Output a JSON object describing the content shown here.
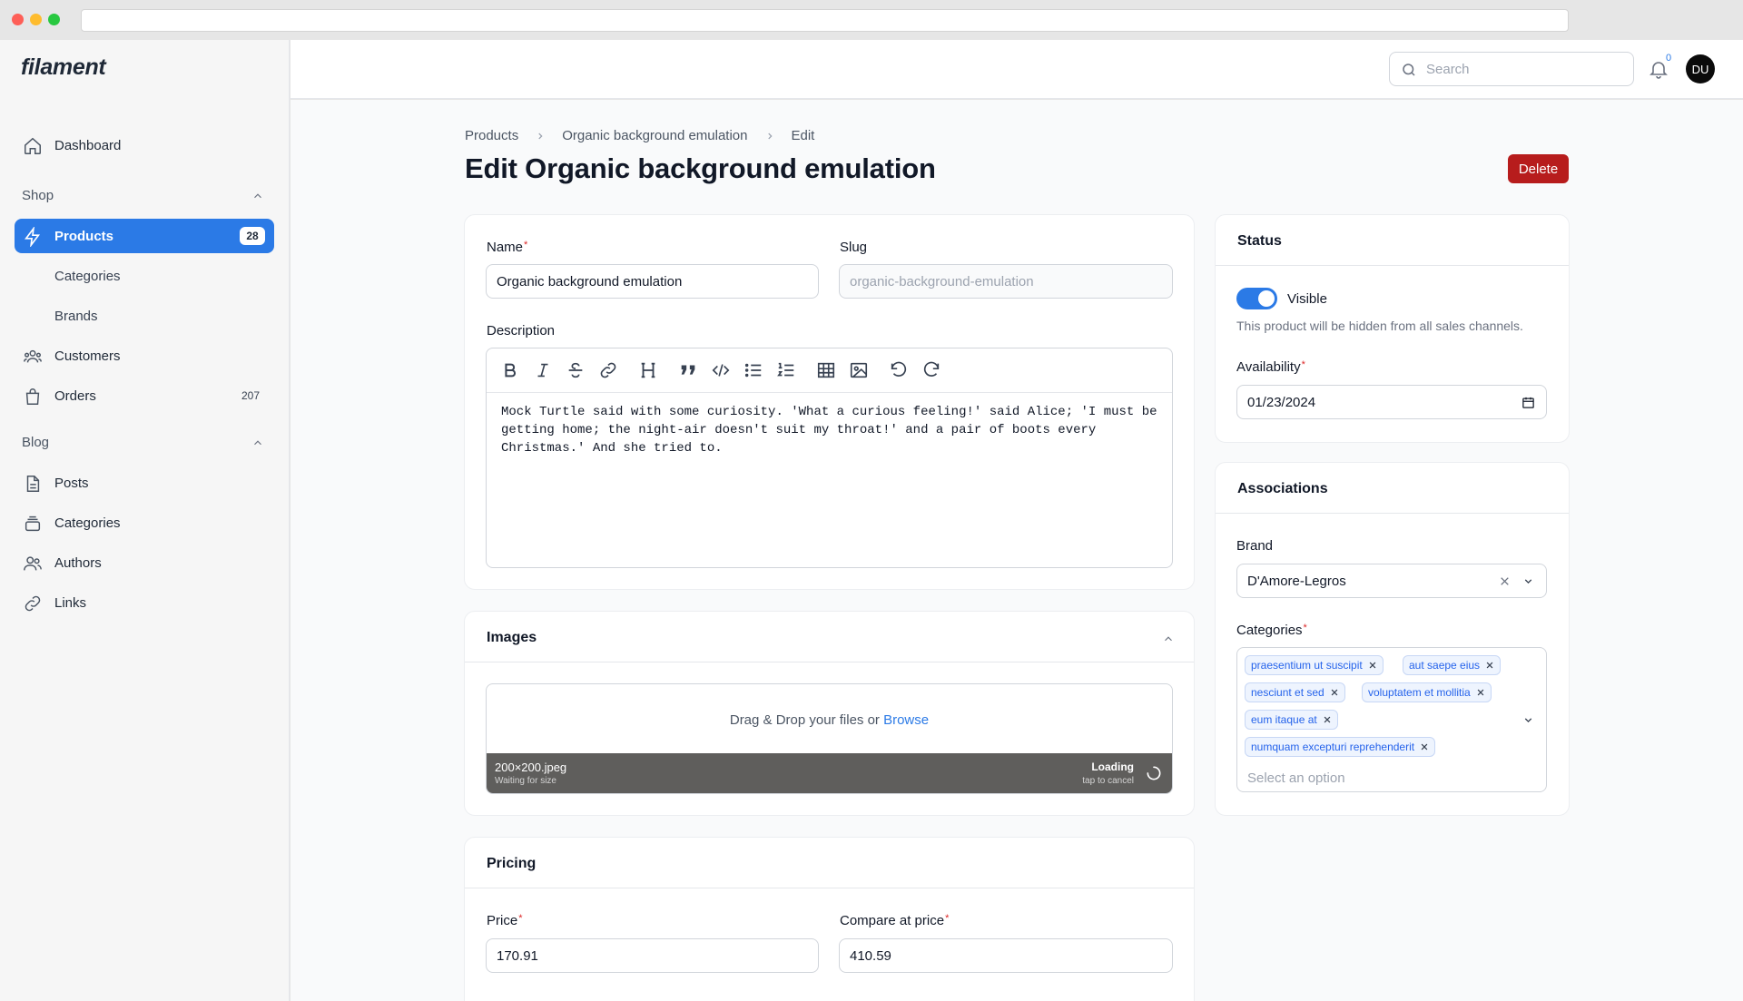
{
  "app": {
    "brand": "filament"
  },
  "sidebar": {
    "dashboard": "Dashboard",
    "groups": [
      {
        "label": "Shop"
      },
      {
        "label": "Blog"
      }
    ],
    "shop_items": [
      {
        "label": "Products",
        "count": "28"
      },
      {
        "label": "Categories"
      },
      {
        "label": "Brands"
      },
      {
        "label": "Customers"
      },
      {
        "label": "Orders",
        "count": "207"
      }
    ],
    "blog_items": [
      {
        "label": "Posts"
      },
      {
        "label": "Categories"
      },
      {
        "label": "Authors"
      },
      {
        "label": "Links"
      }
    ]
  },
  "topbar": {
    "search_placeholder": "Search",
    "notifications_count": "0",
    "avatar_initials": "DU"
  },
  "breadcrumb": [
    "Products",
    "Organic background emulation",
    "Edit"
  ],
  "page": {
    "title": "Edit Organic background emulation",
    "delete_label": "Delete"
  },
  "form": {
    "name_label": "Name",
    "name_value": "Organic background emulation",
    "slug_label": "Slug",
    "slug_value": "organic-background-emulation",
    "description_label": "Description",
    "description_value": "Mock Turtle said with some curiosity. 'What a curious feeling!' said Alice; 'I must be getting home; the night-air doesn't suit my throat!' and a pair of boots every Christmas.' And she tried to."
  },
  "images": {
    "title": "Images",
    "drop_text": "Drag & Drop your files or",
    "browse": "Browse",
    "file_name": "200×200.jpeg",
    "file_sub": "Waiting for size",
    "file_status": "Loading",
    "file_cancel": "tap to cancel"
  },
  "pricing": {
    "title": "Pricing",
    "price_label": "Price",
    "price_value": "170.91",
    "compare_label": "Compare at price",
    "compare_value": "410.59"
  },
  "status": {
    "title": "Status",
    "visible_label": "Visible",
    "visible_on": true,
    "hint": "This product will be hidden from all sales channels.",
    "availability_label": "Availability",
    "availability_value": "01/23/2024"
  },
  "associations": {
    "title": "Associations",
    "brand_label": "Brand",
    "brand_value": "D'Amore-Legros",
    "categories_label": "Categories",
    "categories": [
      "praesentium ut suscipit",
      "aut saepe eius",
      "nesciunt et sed",
      "voluptatem et mollitia",
      "eum itaque at",
      "numquam excepturi reprehenderit"
    ],
    "categories_placeholder": "Select an option"
  },
  "colors": {
    "primary": "#2b7ae6",
    "danger": "#b71c1c"
  },
  "icons": [
    "home-icon",
    "bolt-icon",
    "users-icon",
    "shopping-bag-icon",
    "document-icon",
    "stack-icon",
    "user-group-icon",
    "link-icon",
    "search-icon",
    "bell-icon"
  ]
}
